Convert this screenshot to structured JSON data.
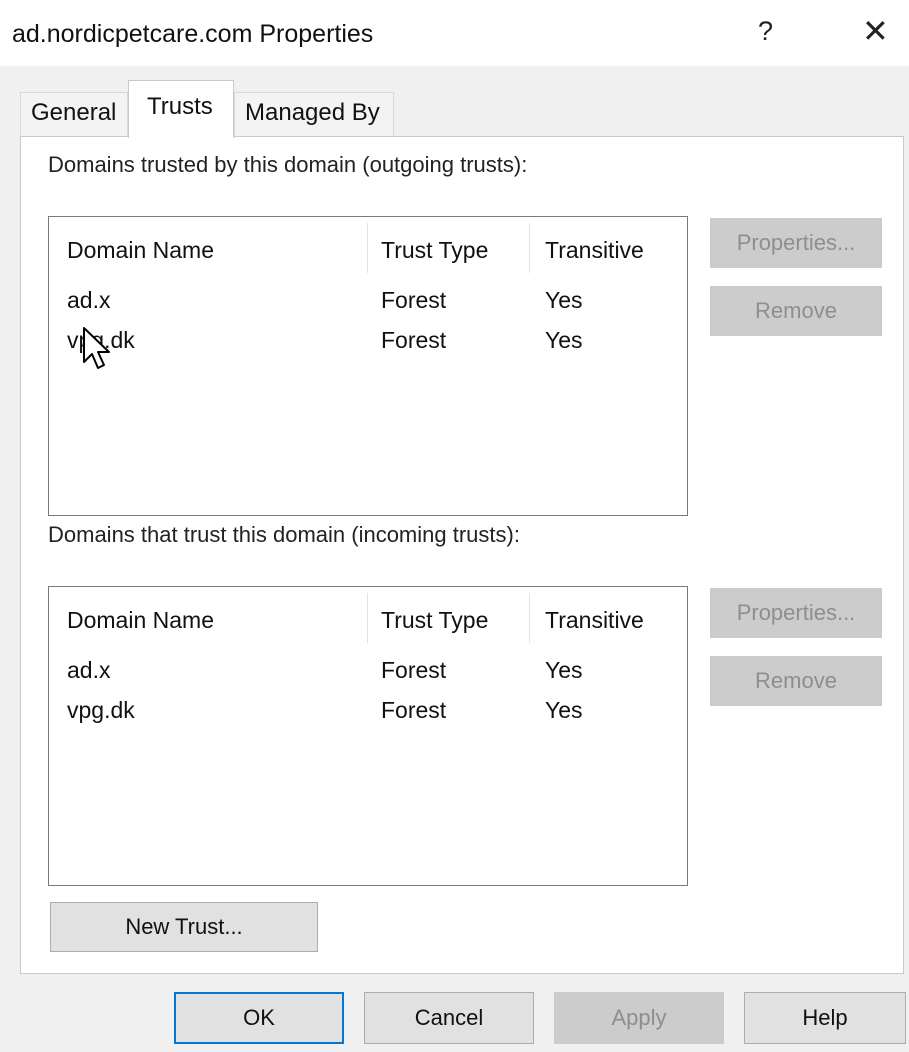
{
  "window": {
    "title": "ad.nordicpetcare.com Properties",
    "help_glyph": "?",
    "close_glyph": "✕"
  },
  "tabs": [
    {
      "label": "General",
      "active": false
    },
    {
      "label": "Trusts",
      "active": true
    },
    {
      "label": "Managed By",
      "active": false
    }
  ],
  "outgoing": {
    "label": "Domains trusted by this domain (outgoing trusts):",
    "columns": [
      "Domain Name",
      "Trust Type",
      "Transitive"
    ],
    "rows": [
      [
        "ad.x",
        "Forest",
        "Yes"
      ],
      [
        "vpg.dk",
        "Forest",
        "Yes"
      ]
    ],
    "properties_label": "Properties...",
    "remove_label": "Remove"
  },
  "incoming": {
    "label": "Domains that trust this domain (incoming trusts):",
    "columns": [
      "Domain Name",
      "Trust Type",
      "Transitive"
    ],
    "rows": [
      [
        "ad.x",
        "Forest",
        "Yes"
      ],
      [
        "vpg.dk",
        "Forest",
        "Yes"
      ]
    ],
    "properties_label": "Properties...",
    "remove_label": "Remove"
  },
  "new_trust_label": "New Trust...",
  "footer": {
    "ok_label": "OK",
    "cancel_label": "Cancel",
    "apply_label": "Apply",
    "help_label": "Help"
  },
  "colors": {
    "accent": "#0078d7",
    "disabled_button": "#cccccc",
    "disabled_text": "#8e8e8e",
    "window_bg": "#f0f0f0"
  }
}
